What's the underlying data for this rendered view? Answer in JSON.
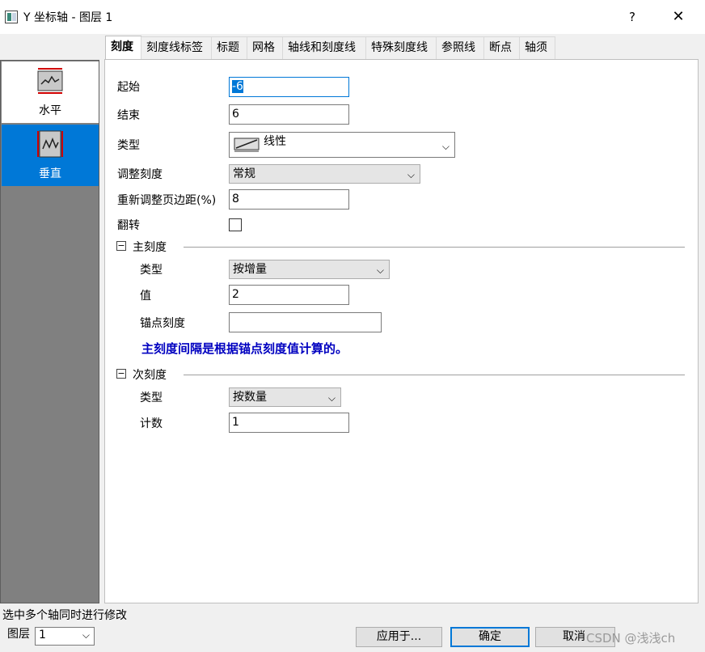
{
  "window": {
    "title": "Y 坐标轴 - 图层 1",
    "help_label": "?",
    "close_label": "✕"
  },
  "sidebar": {
    "items": [
      {
        "label": "水平",
        "icon": "horizontal-axis-icon",
        "selected": false
      },
      {
        "label": "垂直",
        "icon": "vertical-axis-icon",
        "selected": true
      }
    ]
  },
  "tabs": [
    {
      "label": "刻度",
      "active": true
    },
    {
      "label": "刻度线标签",
      "active": false
    },
    {
      "label": "标题",
      "active": false
    },
    {
      "label": "网格",
      "active": false
    },
    {
      "label": "轴线和刻度线",
      "active": false
    },
    {
      "label": "特殊刻度线",
      "active": false
    },
    {
      "label": "参照线",
      "active": false
    },
    {
      "label": "断点",
      "active": false
    },
    {
      "label": "轴须",
      "active": false
    }
  ],
  "form": {
    "start": {
      "label": "起始",
      "value": "-6"
    },
    "end": {
      "label": "结束",
      "value": "6"
    },
    "type": {
      "label": "类型",
      "value": "线性",
      "icon": "linear-scale-icon"
    },
    "rescale": {
      "label": "调整刻度",
      "value": "常规"
    },
    "rescale_margin": {
      "label": "重新调整页边距(%)",
      "value": "8"
    },
    "reverse": {
      "label": "翻转",
      "checked": false
    },
    "major": {
      "title": "主刻度",
      "toggle": "⊟",
      "type": {
        "label": "类型",
        "value": "按增量"
      },
      "value": {
        "label": "值",
        "value": "2"
      },
      "anchor": {
        "label": "锚点刻度",
        "value": ""
      },
      "note": "主刻度间隔是根据锚点刻度值计算的。"
    },
    "minor": {
      "title": "次刻度",
      "toggle": "⊟",
      "type": {
        "label": "类型",
        "value": "按数量"
      },
      "count": {
        "label": "计数",
        "value": "1"
      }
    }
  },
  "footer": {
    "status": "选中多个轴同时进行修改",
    "layer_label": "图层",
    "layer_value": "1",
    "apply_label": "应用于...",
    "ok_label": "确定",
    "cancel_label": "取消"
  },
  "watermark": "CSDN @浅浅ch",
  "colors": {
    "accent": "#0078d7",
    "note_text": "#0000c0",
    "sidebar_bg": "#808080"
  }
}
